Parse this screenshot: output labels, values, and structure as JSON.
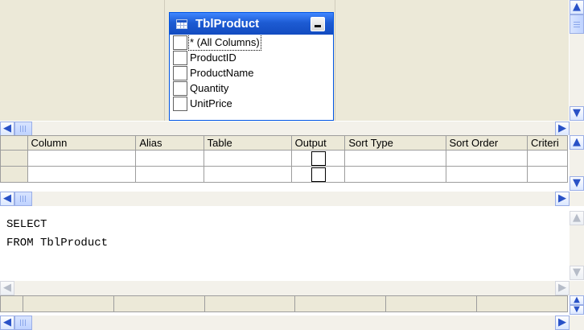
{
  "diagram": {
    "table": {
      "title": "TblProduct",
      "columns": [
        "* (All Columns)",
        "ProductID",
        "ProductName",
        "Quantity",
        "UnitPrice"
      ]
    }
  },
  "grid": {
    "headers": [
      "Column",
      "Alias",
      "Table",
      "Output",
      "Sort Type",
      "Sort Order",
      "Criteri"
    ]
  },
  "sql": {
    "line1": "SELECT",
    "line2": "FROM TblProduct"
  },
  "icons": {
    "scroll_up": "▲",
    "scroll_down": "▼",
    "scroll_left": "◀",
    "scroll_right": "▶"
  },
  "colors": {
    "title_blue": "#1d5bd3",
    "panel_bg": "#ece9d8",
    "scroll_accent": "#2952c7"
  }
}
